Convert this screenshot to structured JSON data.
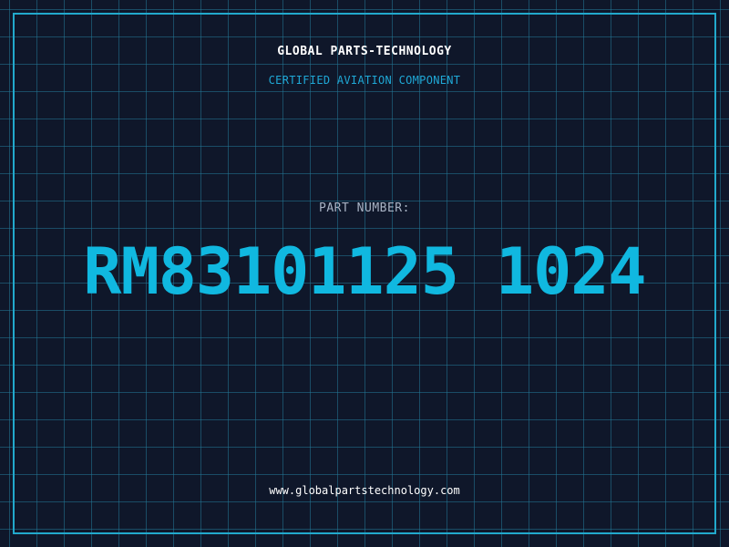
{
  "header": {
    "company": "GLOBAL PARTS-TECHNOLOGY",
    "subtitle": "CERTIFIED AVIATION COMPONENT"
  },
  "part": {
    "label": "PART NUMBER:",
    "number": "RM83101125 1024"
  },
  "footer": {
    "website": "www.globalpartstechnology.com"
  },
  "colors": {
    "background": "#0f172a",
    "grid": "#227896",
    "frame": "#22a9cc",
    "accent": "#10b8e0",
    "label": "#a8b3c4",
    "title": "#ffffff"
  }
}
